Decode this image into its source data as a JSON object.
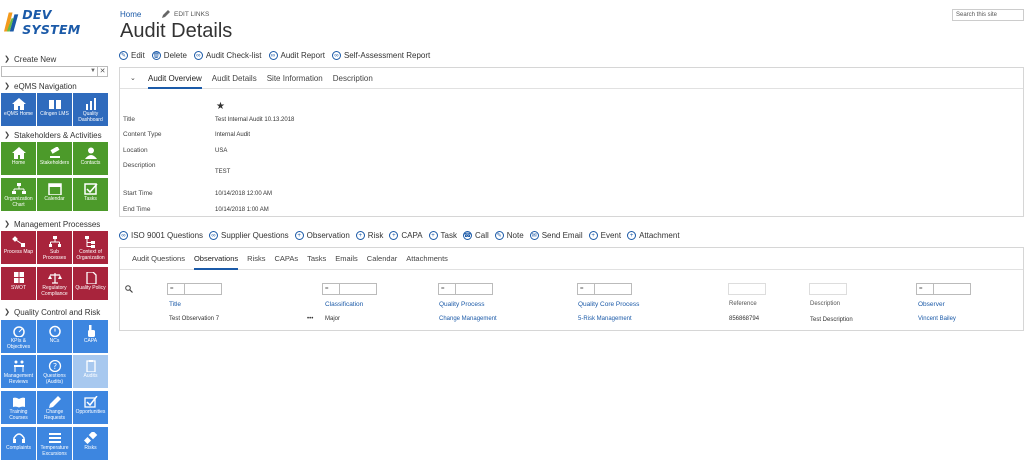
{
  "brand": {
    "name": "DEV SYSTEM"
  },
  "sidebar": {
    "create_new": "Create New",
    "sections": {
      "eqms": "eQMS Navigation",
      "stake": "Stakeholders & Activities",
      "mgmt": "Management Processes",
      "qcr": "Quality Control and Risk"
    },
    "tiles": {
      "eqms_home": "eQMS Home",
      "comply": "Cilngen LMS",
      "qdash": "Quality Dashboard",
      "home": "Home",
      "stakeholders": "Stakeholders",
      "contacts": "Contacts",
      "org_chart": "Organization Chart",
      "calendar": "Calendar",
      "tasks": "Tasks",
      "process_map": "Process Map",
      "sub_processes": "Sub Processes",
      "context": "Context of Organization",
      "swot": "SWOT",
      "regulatory": "Regulatory Compliance",
      "quality_policy": "Quality Policy",
      "kpis": "KPIs & Objectives",
      "ncs": "NCs",
      "capa": "CAPA",
      "mgmt_reviews": "Management Reviews",
      "questions": "Questions (Audits)",
      "audits": "Audits",
      "training": "Training Courses",
      "change_requests": "Change Requests",
      "opportunities": "Opportunities",
      "complaints": "Complaints",
      "temp_excursions": "Temperature Excursions",
      "risks": "Risks"
    }
  },
  "topbar": {
    "home": "Home",
    "edit_links": "EDIT LINKS",
    "search_placeholder": "Search this site"
  },
  "page": {
    "title": "Audit Details"
  },
  "actions": {
    "edit": "Edit",
    "delete": "Delete",
    "checklist": "Audit Check-list",
    "report": "Audit Report",
    "self_assess": "Self-Assessment Report"
  },
  "overview": {
    "tabs": [
      "Audit Overview",
      "Audit Details",
      "Site Information",
      "Description"
    ],
    "fields": {
      "title_label": "Title",
      "title_value": "Test Internal Audit 10.13.2018",
      "ctype_label": "Content Type",
      "ctype_value": "Internal Audit",
      "loc_label": "Location",
      "loc_value": "USA",
      "desc_label": "Description",
      "desc_value": "TEST",
      "start_label": "Start Time",
      "start_value": "10/14/2018 12:00 AM",
      "end_label": "End Time",
      "end_value": "10/14/2018 1:00 AM"
    }
  },
  "toolbar2": {
    "iso": "ISO 9001 Questions",
    "supplier": "Supplier Questions",
    "observation": "Observation",
    "risk": "Risk",
    "capa": "CAPA",
    "task": "Task",
    "call": "Call",
    "note": "Note",
    "email": "Send Email",
    "event": "Event",
    "attachment": "Attachment"
  },
  "obs": {
    "tabs": [
      "Audit Questions",
      "Observations",
      "Risks",
      "CAPAs",
      "Tasks",
      "Emails",
      "Calendar",
      "Attachments"
    ],
    "filter_op": "=",
    "columns": {
      "title": "Title",
      "classification": "Classification",
      "qprocess": "Quality Process",
      "qcore": "Quality Core Process",
      "reference": "Reference",
      "description": "Description",
      "observer": "Observer"
    },
    "row": {
      "title": "Test Observation 7",
      "more": "•••",
      "classification": "Major",
      "qprocess": "Change Management",
      "qcore": "5-Risk Management",
      "reference": "856868794",
      "description": "Test Description",
      "observer": "Vincent Bailey"
    }
  }
}
